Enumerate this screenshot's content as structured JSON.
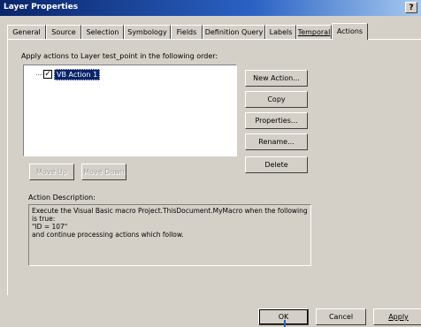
{
  "window": {
    "title": "Layer Properties",
    "help_label": "?"
  },
  "tabs": [
    {
      "label": "General"
    },
    {
      "label": "Source"
    },
    {
      "label": "Selection"
    },
    {
      "label": "Symbology"
    },
    {
      "label": "Fields"
    },
    {
      "label": "Definition Query"
    },
    {
      "label": "Labels"
    },
    {
      "label": "Temporal"
    },
    {
      "label": "Actions",
      "active": true
    }
  ],
  "actions_panel": {
    "instruction": "Apply actions to Layer test_point in the following order:",
    "list_items": [
      {
        "label": "VB Action 1",
        "checked": true,
        "selected": true
      }
    ],
    "checkmark": "✓",
    "buttons": {
      "new_action": "New Action...",
      "copy": "Copy",
      "properties": "Properties...",
      "rename": "Rename...",
      "delete": "Delete",
      "move_up": "Move Up",
      "move_down": "Move Down"
    },
    "description_label": "Action Description:",
    "description_lines": [
      "Execute the Visual Basic macro Project.ThisDocument.MyMacro when the following",
      "is true:",
      "\"ID = 107\"",
      "and continue processing actions which follow."
    ]
  },
  "footer": {
    "ok": "OK",
    "cancel": "Cancel",
    "apply": "Apply"
  }
}
